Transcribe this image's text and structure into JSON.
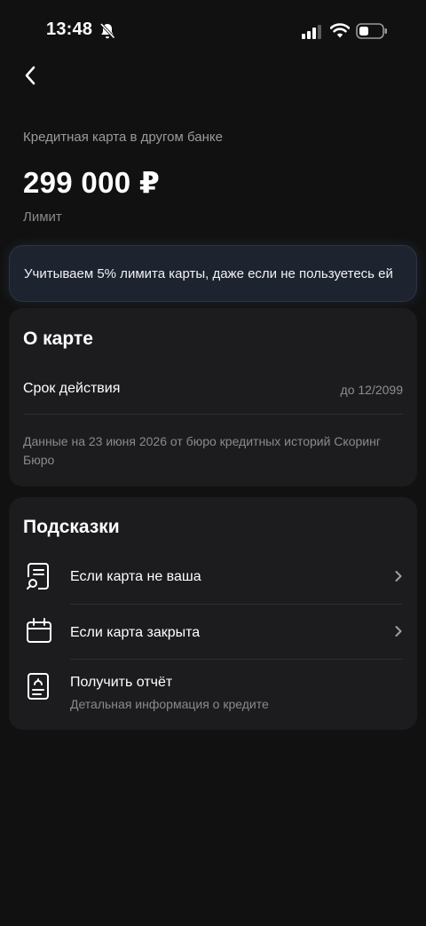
{
  "status_bar": {
    "time": "13:48",
    "icons": [
      "bell-slash-icon",
      "signal-icon",
      "wifi-icon",
      "battery-icon"
    ]
  },
  "header": {
    "back_icon": "chevron-left-icon"
  },
  "summary": {
    "product_name": "Кредитная карта в другом банке",
    "limit_amount": "299 000 ₽",
    "limit_label": "Лимит"
  },
  "notice": {
    "text": "Учитываем 5% лимита карты, даже если не пользуетесь ей"
  },
  "about": {
    "title": "О карте",
    "validity_label": "Срок действия",
    "validity_value": "до 12/2099",
    "bureau_note": "Данные на 23 июня 2026 от бюро кредитных историй Скоринг Бюро"
  },
  "tips": {
    "title": "Подсказки",
    "items": [
      {
        "label": "Если карта не ваша",
        "icon": "document-search-icon"
      },
      {
        "label": "Если карта закрыта",
        "icon": "calendar-icon"
      },
      {
        "label": "Получить отчёт",
        "sublabel": "Детальная информация о кредите",
        "icon": "report-icon"
      }
    ]
  },
  "colors": {
    "background": "#111111",
    "card": "#1c1c1e",
    "notice_bg": "#1d2430",
    "muted_text": "#8a8a8a"
  }
}
